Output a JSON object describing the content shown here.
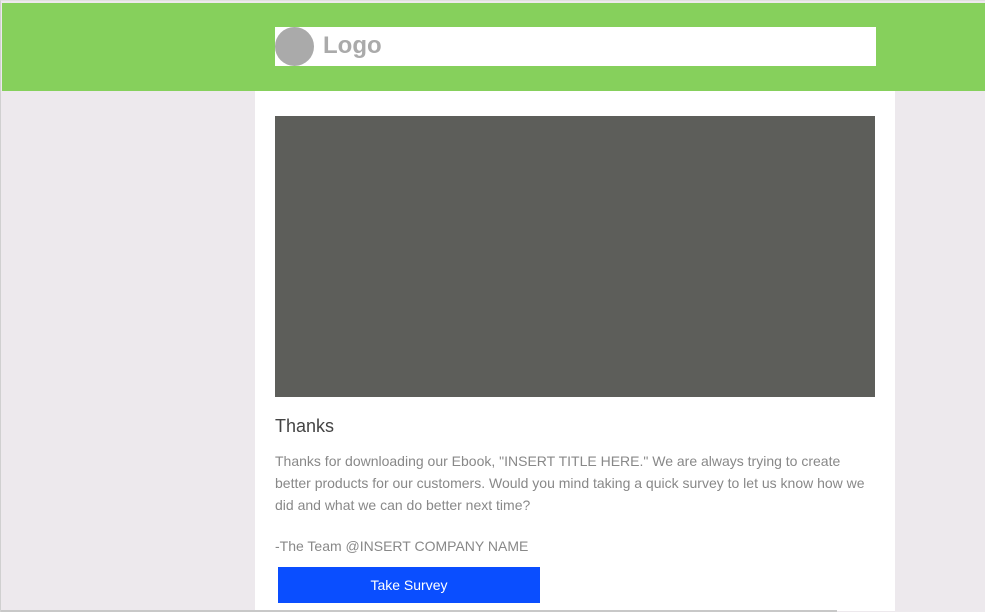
{
  "header": {
    "logo_text": "Logo"
  },
  "email": {
    "title": "Thanks",
    "body": "Thanks for downloading our Ebook, \"INSERT TITLE HERE.\" We are always trying to create better products for our customers. Would you mind taking a quick survey to let us know how we did and what we can do better next time?",
    "signature": "-The Team @INSERT COMPANY NAME",
    "button_label": "Take Survey"
  },
  "colors": {
    "header_bg": "#86d05c",
    "page_bg": "#ede9ed",
    "image_placeholder": "#5d5e5a",
    "button_bg": "#0a4eff",
    "logo_placeholder": "#aaaaaa"
  }
}
